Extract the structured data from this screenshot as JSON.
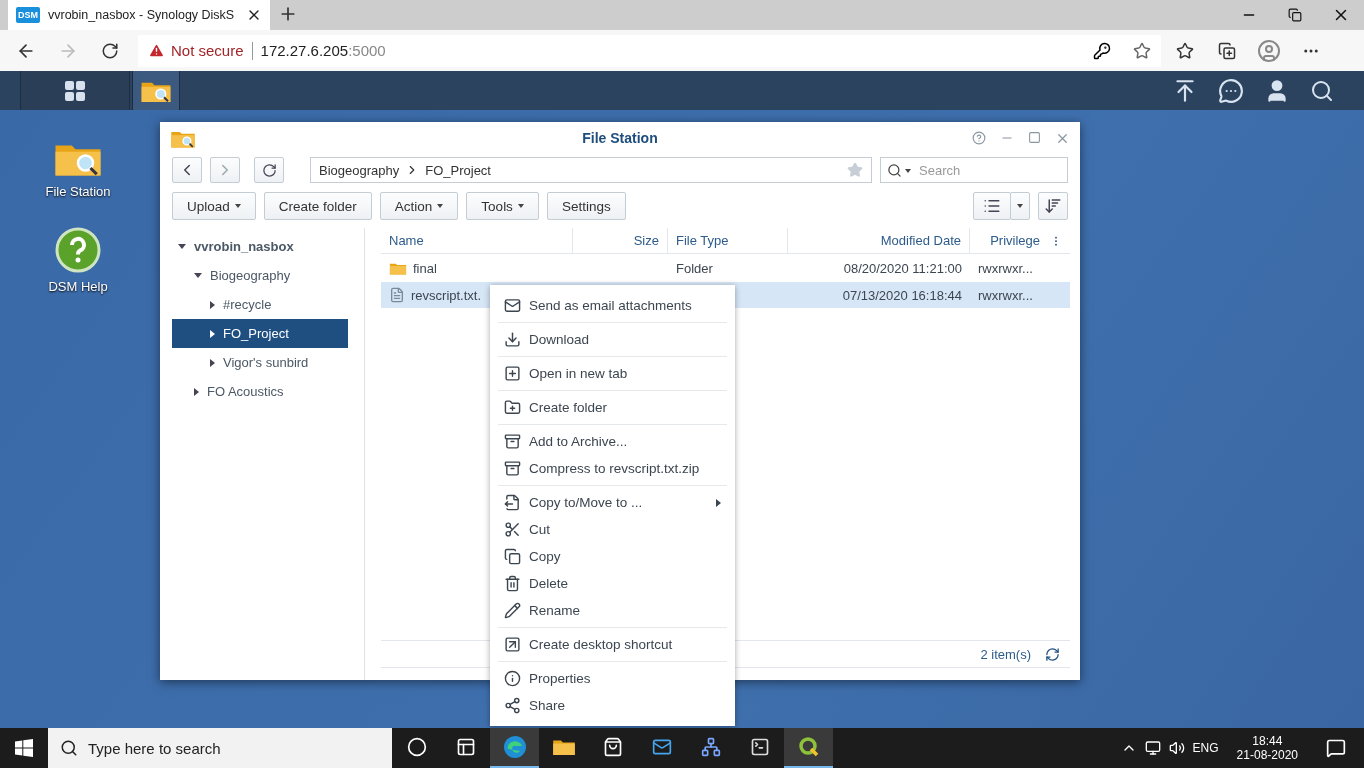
{
  "browser": {
    "tab": {
      "favicon_text": "DSM",
      "title": "vvrobin_nasbox - Synology DiskS"
    },
    "security": "Not secure",
    "host": "172.27.6.205",
    "port": ":5000"
  },
  "dsm_taskbar": {
    "apps": [
      {
        "kind": "grid",
        "selected": false
      },
      {
        "kind": "filestation",
        "selected": true
      }
    ]
  },
  "desktop_icons": [
    {
      "kind": "filestation",
      "label": "File Station"
    },
    {
      "kind": "help",
      "label": "DSM Help"
    }
  ],
  "window": {
    "title": "File Station",
    "path": [
      "Biogeography",
      "FO_Project"
    ],
    "search": {
      "placeholder": "Search"
    },
    "toolbar": [
      {
        "label": "Upload",
        "dropdown": true
      },
      {
        "label": "Create folder",
        "dropdown": false
      },
      {
        "label": "Action",
        "dropdown": true
      },
      {
        "label": "Tools",
        "dropdown": true
      },
      {
        "label": "Settings",
        "dropdown": false
      }
    ],
    "tree": [
      {
        "label": "vvrobin_nasbox",
        "expanded": true,
        "selected": false,
        "children": [
          {
            "label": "Biogeography",
            "expanded": true,
            "selected": false,
            "children": [
              {
                "label": "#recycle",
                "expanded": false,
                "selected": false
              },
              {
                "label": "FO_Project",
                "expanded": false,
                "selected": true
              },
              {
                "label": "Vigor's sunbird",
                "expanded": false,
                "selected": false
              }
            ]
          },
          {
            "label": "FO Acoustics",
            "expanded": false,
            "selected": false
          }
        ]
      }
    ],
    "table": {
      "columns": [
        "Name",
        "Size",
        "File Type",
        "Modified Date",
        "Privilege"
      ],
      "rows": [
        {
          "kind": "folder",
          "selected": false,
          "name": "final",
          "type": "Folder",
          "modified": "08/20/2020 11:21:00",
          "privilege": "rwxrwxr..."
        },
        {
          "kind": "file",
          "selected": true,
          "name": "revscript.txt.",
          "modified": "07/13/2020 16:18:44",
          "privilege": "rwxrwxr..."
        }
      ]
    },
    "status": "2 item(s)"
  },
  "context_menu": [
    [
      {
        "label": "Send as email attachments",
        "submenu": false
      }
    ],
    [
      {
        "label": "Download",
        "submenu": false
      }
    ],
    [
      {
        "label": "Open in new tab",
        "submenu": false
      }
    ],
    [
      {
        "label": "Create folder",
        "submenu": false
      }
    ],
    [
      {
        "label": "Add to Archive...",
        "submenu": false
      },
      {
        "label": "Compress to revscript.txt.zip",
        "submenu": false
      }
    ],
    [
      {
        "label": "Copy to/Move to ...",
        "submenu": true
      },
      {
        "label": "Cut",
        "submenu": false
      },
      {
        "label": "Copy",
        "submenu": false
      },
      {
        "label": "Delete",
        "submenu": false
      },
      {
        "label": "Rename",
        "submenu": false
      }
    ],
    [
      {
        "label": "Create desktop shortcut",
        "submenu": false
      }
    ],
    [
      {
        "label": "Properties",
        "submenu": false
      },
      {
        "label": "Share",
        "submenu": false
      }
    ]
  ],
  "taskbar": {
    "search_placeholder": "Type here to search",
    "pinned": [
      {
        "kind": "cortana",
        "selected": false
      },
      {
        "kind": "taskview",
        "selected": false
      },
      {
        "kind": "edge",
        "selected": true
      },
      {
        "kind": "explorer",
        "selected": false
      },
      {
        "kind": "store",
        "selected": false
      },
      {
        "kind": "mail",
        "selected": false
      },
      {
        "kind": "network",
        "selected": false
      },
      {
        "kind": "terminal",
        "selected": false
      },
      {
        "kind": "qgis",
        "selected": true
      }
    ],
    "language": "ENG",
    "time": "18:44",
    "date": "21-08-2020"
  }
}
